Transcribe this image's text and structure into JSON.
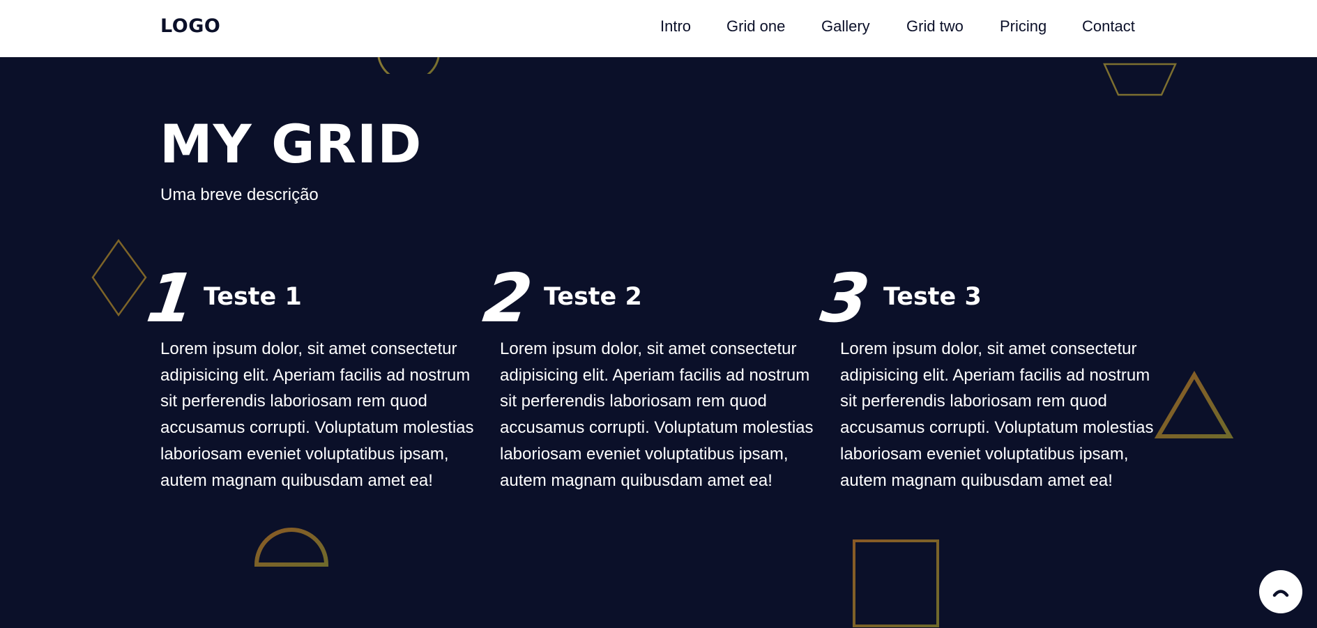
{
  "header": {
    "logo": "LOGO",
    "nav": [
      {
        "label": "Intro"
      },
      {
        "label": "Grid one"
      },
      {
        "label": "Gallery"
      },
      {
        "label": "Grid two"
      },
      {
        "label": "Pricing"
      },
      {
        "label": "Contact"
      }
    ]
  },
  "hero": {
    "title": "MY GRID",
    "subtitle": "Uma breve descrição"
  },
  "cards": [
    {
      "number": "1",
      "title": "Teste 1",
      "text": "Lorem ipsum dolor, sit amet consectetur adipisicing elit. Aperiam facilis ad nostrum sit perferendis laboriosam rem quod accusamus corrupti. Voluptatum molestias laboriosam eveniet voluptatibus ipsam, autem magnam quibusdam amet ea!"
    },
    {
      "number": "2",
      "title": "Teste 2",
      "text": "Lorem ipsum dolor, sit amet consectetur adipisicing elit. Aperiam facilis ad nostrum sit perferendis laboriosam rem quod accusamus corrupti. Voluptatum molestias laboriosam eveniet voluptatibus ipsam, autem magnam quibusdam amet ea!"
    },
    {
      "number": "3",
      "title": "Teste 3",
      "text": "Lorem ipsum dolor, sit amet consectetur adipisicing elit. Aperiam facilis ad nostrum sit perferendis laboriosam rem quod accusamus corrupti. Voluptatum molestias laboriosam eveniet voluptatibus ipsam, autem magnam quibusdam amet ea!"
    }
  ],
  "scroll_top": {
    "icon": "chevron-up-icon"
  },
  "colors": {
    "background": "#0b1029",
    "header": "#ffffff",
    "text": "#ffffff",
    "decoration_gold": "#8a7a35",
    "decoration_copper": "#8a5a25"
  }
}
